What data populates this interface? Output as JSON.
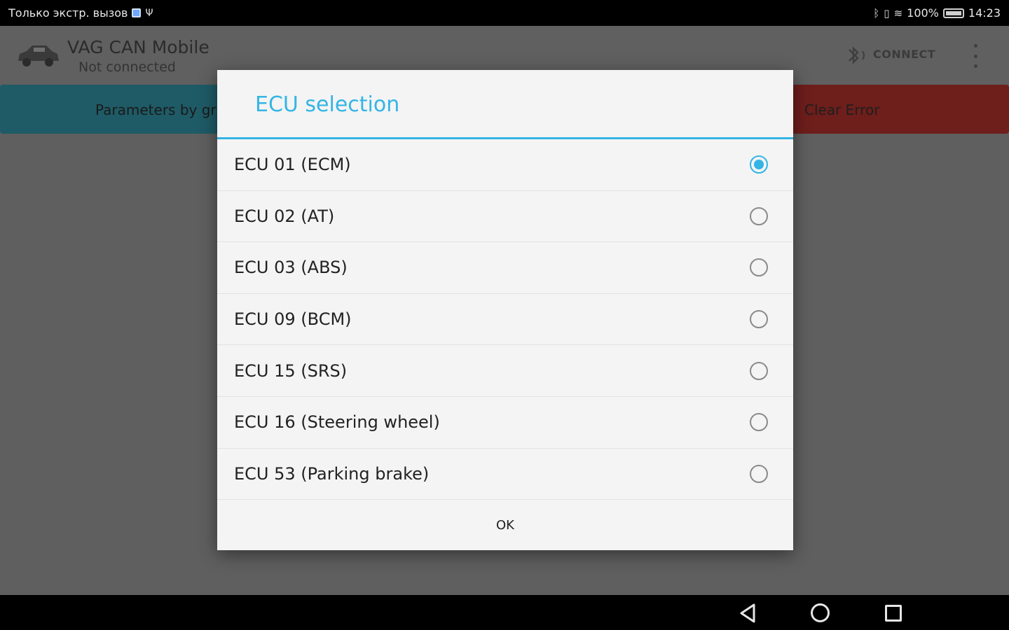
{
  "status_bar": {
    "carrier": "Только экстр. вызов",
    "battery_percent": "100%",
    "time": "14:23",
    "icons": [
      "sim-icon",
      "usb-icon",
      "bluetooth-icon",
      "vibrate-icon",
      "wifi-icon",
      "battery-icon"
    ]
  },
  "app_bar": {
    "title": "VAG CAN Mobile",
    "subtitle": "Not connected",
    "connect_label": "CONNECT",
    "icons": [
      "car-icon",
      "bluetooth-icon",
      "overflow-menu-icon"
    ]
  },
  "background_buttons": {
    "left_label": "Parameters by gr",
    "right_label": "Clear Error"
  },
  "dialog": {
    "title": "ECU selection",
    "options": [
      {
        "label": "ECU 01 (ECM)",
        "selected": true
      },
      {
        "label": "ECU 02 (AT)",
        "selected": false
      },
      {
        "label": "ECU 03 (ABS)",
        "selected": false
      },
      {
        "label": "ECU 09 (BCM)",
        "selected": false
      },
      {
        "label": "ECU 15 (SRS)",
        "selected": false
      },
      {
        "label": "ECU 16 (Steering wheel)",
        "selected": false
      },
      {
        "label": "ECU 53 (Parking brake)",
        "selected": false
      }
    ],
    "ok_label": "OK"
  },
  "nav_bar": {
    "icons": [
      "back-icon",
      "home-icon",
      "recents-icon"
    ]
  },
  "colors": {
    "accent": "#33b5e5",
    "params_button": "#1e5b66",
    "clear_button": "#6e1e1b"
  }
}
